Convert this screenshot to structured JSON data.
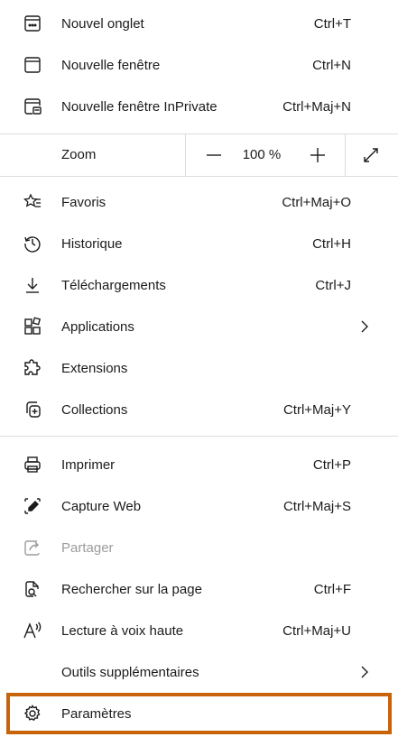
{
  "menu": {
    "items": [
      {
        "label": "Nouvel onglet",
        "shortcut": "Ctrl+T",
        "icon": "new-tab-icon"
      },
      {
        "label": "Nouvelle fenêtre",
        "shortcut": "Ctrl+N",
        "icon": "new-window-icon"
      },
      {
        "label": "Nouvelle fenêtre InPrivate",
        "shortcut": "Ctrl+Maj+N",
        "icon": "inprivate-window-icon"
      },
      {
        "label": "Favoris",
        "shortcut": "Ctrl+Maj+O",
        "icon": "favorites-icon"
      },
      {
        "label": "Historique",
        "shortcut": "Ctrl+H",
        "icon": "history-icon"
      },
      {
        "label": "Téléchargements",
        "shortcut": "Ctrl+J",
        "icon": "downloads-icon"
      },
      {
        "label": "Applications",
        "shortcut": "",
        "icon": "applications-icon"
      },
      {
        "label": "Extensions",
        "shortcut": "",
        "icon": "extensions-icon"
      },
      {
        "label": "Collections",
        "shortcut": "Ctrl+Maj+Y",
        "icon": "collections-icon"
      },
      {
        "label": "Imprimer",
        "shortcut": "Ctrl+P",
        "icon": "print-icon"
      },
      {
        "label": "Capture Web",
        "shortcut": "Ctrl+Maj+S",
        "icon": "web-capture-icon"
      },
      {
        "label": "Partager",
        "shortcut": "",
        "icon": "share-icon"
      },
      {
        "label": "Rechercher sur la page",
        "shortcut": "Ctrl+F",
        "icon": "find-on-page-icon"
      },
      {
        "label": "Lecture à voix haute",
        "shortcut": "Ctrl+Maj+U",
        "icon": "read-aloud-icon"
      },
      {
        "label": "Outils supplémentaires",
        "shortcut": "",
        "icon": ""
      },
      {
        "label": "Paramètres",
        "shortcut": "",
        "icon": "settings-icon"
      }
    ],
    "zoom": {
      "label": "Zoom",
      "value": "100 %",
      "minus": "—",
      "plus": "+"
    },
    "highlight_color": "#c9630a"
  }
}
